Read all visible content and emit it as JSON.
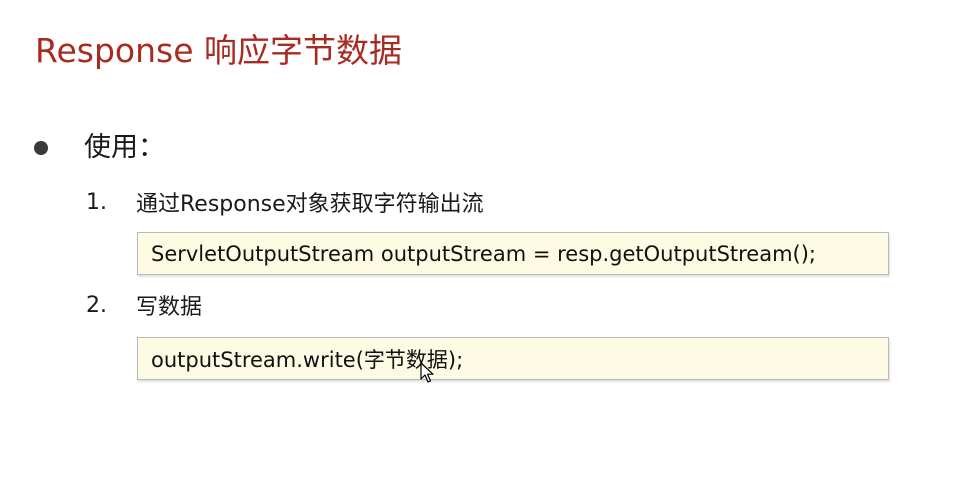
{
  "slide": {
    "title": "Response 响应字节数据",
    "bullet": "使用：",
    "steps": [
      {
        "number": "1.",
        "text": "通过Response对象获取字符输出流"
      },
      {
        "number": "2.",
        "text": "写数据"
      }
    ],
    "code": [
      "ServletOutputStream outputStream = resp.getOutputStream();",
      "outputStream.write(字节数据);"
    ]
  },
  "colors": {
    "title": "#a82a20",
    "code_background": "#fdfbe4",
    "code_border": "#b9b9b9"
  },
  "icons": {
    "bullet": "filled-circle-bullet",
    "pointer": "mouse-pointer-icon"
  }
}
